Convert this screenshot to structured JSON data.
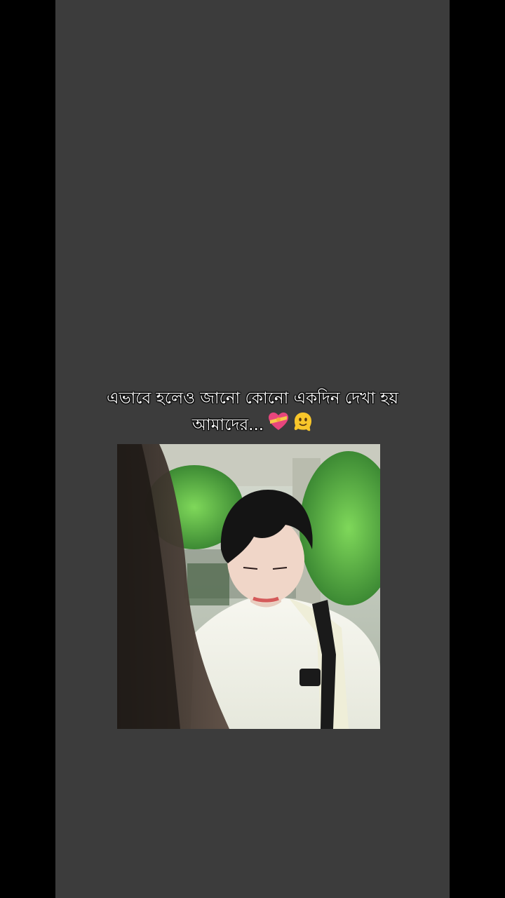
{
  "caption": {
    "line1": "এভাবে হলেও জানো কোনো একদিন দেখা হয়",
    "line2": "আমাদের...",
    "emoji_1": "heart-with-ribbon-icon",
    "emoji_2": "melting-face-icon"
  },
  "colors": {
    "page_background": "#000000",
    "panel_background": "#3c3c3c",
    "caption_text": "#ffffff"
  }
}
